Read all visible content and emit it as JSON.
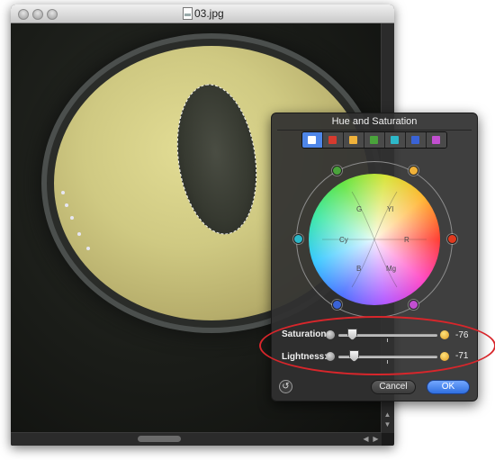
{
  "window": {
    "title": "03.jpg"
  },
  "hud": {
    "title": "Hue and Saturation",
    "swatches": [
      {
        "name": "all",
        "color": "#ffffff"
      },
      {
        "name": "red",
        "color": "#d63a2e"
      },
      {
        "name": "yellow",
        "color": "#f0b23a"
      },
      {
        "name": "green",
        "color": "#4aa33b"
      },
      {
        "name": "cyan",
        "color": "#2db8c9"
      },
      {
        "name": "blue",
        "color": "#3a63d6"
      },
      {
        "name": "magenta",
        "color": "#c24fd0"
      }
    ],
    "wheel": {
      "labels": {
        "g": "G",
        "yl": "Yl",
        "cy": "Cy",
        "r": "R",
        "b": "B",
        "mg": "Mg"
      }
    },
    "saturation": {
      "label": "Saturation:",
      "value": "-76"
    },
    "lightness": {
      "label": "Lightness:",
      "value": "-71"
    },
    "buttons": {
      "cancel": "Cancel",
      "ok": "OK"
    }
  },
  "colors": {
    "highlight_ring": "#d8262b",
    "ok_button": "#3a7de6"
  },
  "icons": {
    "reset": "reset-icon",
    "document": "document-icon"
  }
}
